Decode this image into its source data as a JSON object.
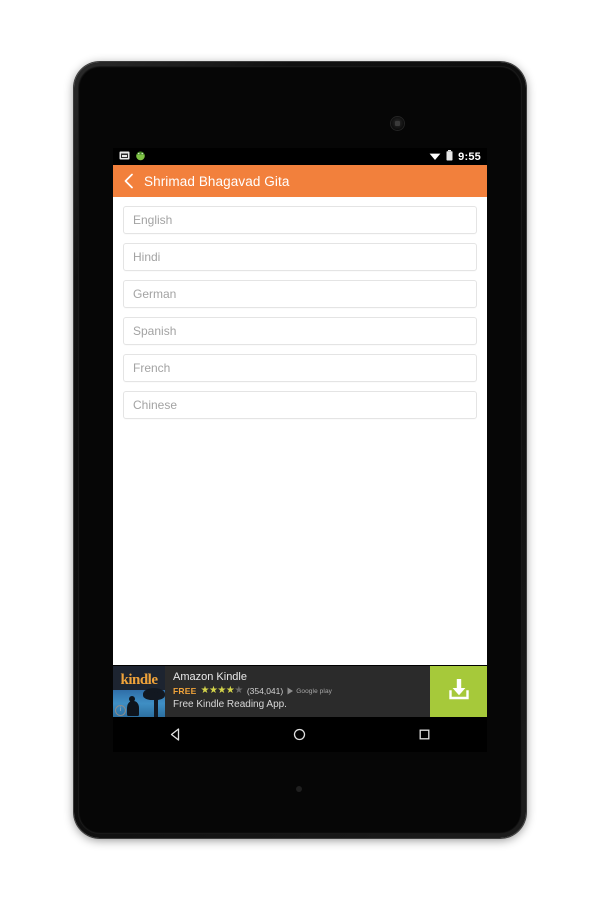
{
  "device": {
    "type": "android-tablet",
    "camera_icon": "front-camera-icon",
    "mic_icon": "microphone-icon"
  },
  "status_bar": {
    "icons_left": [
      "screenshot-icon",
      "android-app-icon"
    ],
    "icons_right": [
      "wifi-icon",
      "battery-icon"
    ],
    "time": "9:55"
  },
  "title_bar": {
    "back_icon": "chevron-left-icon",
    "title": "Shrimad Bhagavad Gita",
    "background_color": "#f2803c"
  },
  "language_list": {
    "items": [
      {
        "label": "English"
      },
      {
        "label": "Hindi"
      },
      {
        "label": "German"
      },
      {
        "label": "Spanish"
      },
      {
        "label": "French"
      },
      {
        "label": "Chinese"
      }
    ]
  },
  "ad_banner": {
    "app_icon_label": "kindle",
    "app_icon_badge": "i",
    "title": "Amazon Kindle",
    "price": "FREE",
    "rating": 4,
    "rating_max": 5,
    "reviews": "(354,041)",
    "store_badge": "Google play",
    "subtitle": "Free Kindle Reading App.",
    "cta_icon": "download-icon",
    "cta_color": "#a6c93a",
    "background_color": "#2b2b2b"
  },
  "nav_bar": {
    "buttons": [
      {
        "name": "back",
        "icon": "triangle-back-icon"
      },
      {
        "name": "home",
        "icon": "circle-home-icon"
      },
      {
        "name": "recents",
        "icon": "square-recents-icon"
      }
    ]
  }
}
